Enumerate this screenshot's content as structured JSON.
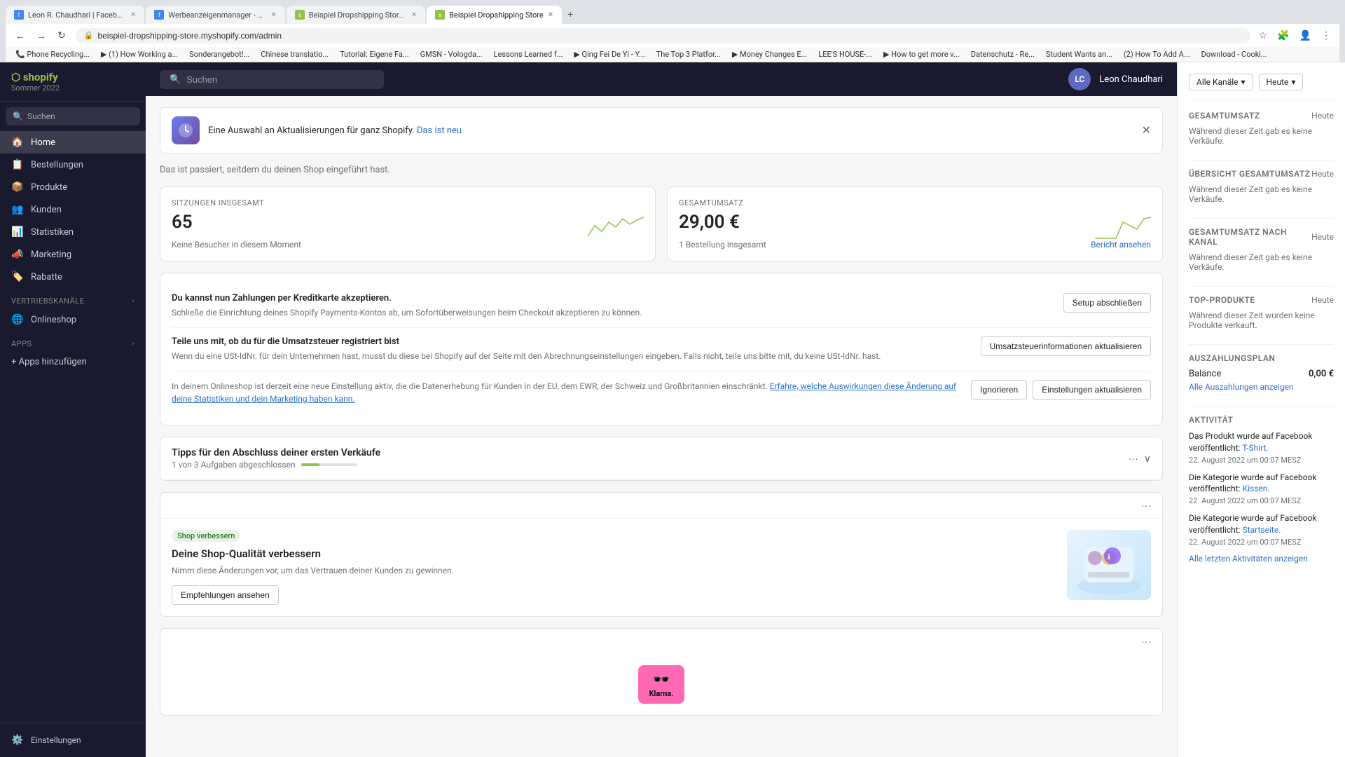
{
  "browser": {
    "tabs": [
      {
        "label": "Leon R. Chaudhari | Facebook",
        "active": false,
        "favicon": "f"
      },
      {
        "label": "Werbeanzeigenmanager - W...",
        "active": false,
        "favicon": "f"
      },
      {
        "label": "Beispiel Dropshipping Store ...",
        "active": false,
        "favicon": "s"
      },
      {
        "label": "Beispiel Dropshipping Store",
        "active": true,
        "favicon": "s"
      }
    ],
    "address": "beispiel-dropshipping-store.myshopify.com/admin",
    "bookmarks": [
      "Phone Recycling...",
      "(1) How Working a...",
      "Sonderangebot!...",
      "Chinese translatio...",
      "Tutorial: Eigene Fa...",
      "GMSN - Vologda...",
      "Lessons Learned f...",
      "Qing Fei De Yi - Y...",
      "The Top 3 Platfor...",
      "Money Changes E...",
      "LEE'S HOUSE-...",
      "How to get more v...",
      "Datenschutz - Re...",
      "Student Wants an...",
      "(2) How To Add A...",
      "Download - Cooki..."
    ]
  },
  "shopify": {
    "logo": "shopify",
    "subtitle": "Sommer 2022",
    "search_placeholder": "Suchen"
  },
  "sidebar": {
    "nav_items": [
      {
        "id": "home",
        "label": "Home",
        "icon": "🏠",
        "active": true
      },
      {
        "id": "bestellungen",
        "label": "Bestellungen",
        "icon": "📋",
        "active": false
      },
      {
        "id": "produkte",
        "label": "Produkte",
        "icon": "📦",
        "active": false
      },
      {
        "id": "kunden",
        "label": "Kunden",
        "icon": "👥",
        "active": false
      },
      {
        "id": "statistiken",
        "label": "Statistiken",
        "icon": "📊",
        "active": false
      },
      {
        "id": "marketing",
        "label": "Marketing",
        "icon": "📣",
        "active": false
      },
      {
        "id": "rabatte",
        "label": "Rabatte",
        "icon": "🏷️",
        "active": false
      }
    ],
    "vertriebskanaele_label": "Vertriebskanäle",
    "onlineshop_label": "Onlineshop",
    "apps_label": "Apps",
    "add_app_label": "+ Apps hinzufügen",
    "settings_label": "Einstellungen"
  },
  "topbar": {
    "search_placeholder": "Suchen",
    "user_initials": "LC",
    "user_name": "Leon Chaudhari"
  },
  "notification": {
    "text": "Eine Auswahl an Aktualisierungen für ganz Shopify.",
    "link_text": "Das ist neu"
  },
  "intro_text": "Das ist passiert, seitdem du deinen Shop eingeführt hast.",
  "stats": {
    "sessions_label": "SITZUNGEN INSGESAMT",
    "sessions_value": "65",
    "sessions_footer": "Keine Besucher in diesem Moment",
    "revenue_label": "GESAMTUMSATZ",
    "revenue_value": "29,00 €",
    "revenue_footer": "1 Bestellung insgesamt",
    "report_link": "Bericht ansehen"
  },
  "setup_items": [
    {
      "title": "Du kannst nun Zahlungen per Kreditkarte akzeptieren.",
      "desc": "Schließe die Einrichtung deines Shopify Payments-Kontos ab, um Sofortüberweisungen beim Checkout akzeptieren zu können.",
      "button": "Setup abschließen"
    },
    {
      "title": "Teile uns mit, ob du für die Umsatzsteuer registriert bist",
      "desc": "Wenn du eine USt-IdNr. für dein Unternehmen hast, musst du diese bei Shopify auf der Seite mit den Abrechnungseinstellungen eingeben. Falls nicht, teile uns bitte mit, du keine USt-IdNr. hast.",
      "button": "Umsatzsteuerinformationen aktualisieren"
    },
    {
      "title": "",
      "desc": "In deinem Onlineshop ist derzeit eine neue Einstellung aktiv, die die Datenerhebung für Kunden in der EU, dem EWR, der Schweiz und Großbritannien einschränkt.",
      "desc_link_text": "Erfahre, welche Auswirkungen diese Änderung auf deine Statistiken und dein Marketing haben kann.",
      "button_ignore": "Ignorieren",
      "button_update": "Einstellungen aktualisieren"
    }
  ],
  "tips": {
    "title": "Tipps für den Abschluss deiner ersten Verkäufe",
    "progress_text": "1 von 3 Aufgaben abgeschlossen",
    "progress_percent": 33
  },
  "quality_card": {
    "badge": "Shop verbessern",
    "title": "Deine Shop-Qualität verbessern",
    "desc": "Nimm diese Änderungen vor, um das Vertrauen deiner Kunden zu gewinnen.",
    "button": "Empfehlungen ansehen"
  },
  "right_panel": {
    "channel_label": "Alle Kanäle",
    "date_label": "Heute",
    "total_revenue_label": "GESAMTUMSATZ",
    "total_revenue_value": "Heute",
    "total_revenue_note": "Während dieser Zeit gab es keine Verkäufe.",
    "overview_label": "ÜBERSICHT GESAMTUMSATZ",
    "overview_value": "Heute",
    "overview_note": "Während dieser Zeit gab es keine Verkäufe.",
    "by_channel_label": "GESAMTUMSATZ NACH KANAL",
    "by_channel_value": "Heute",
    "by_channel_note": "Während dieser Zeit gab es keine Verkäufe.",
    "top_products_label": "TOP-PRODUKTE",
    "top_products_value": "Heute",
    "top_products_note": "Während dieser Zeit wurden keine Produkte verkauft.",
    "payout_label": "AUSZAHLUNGSPLAN",
    "balance_label": "Balance",
    "balance_value": "0,00 €",
    "all_payouts_link": "Alle Auszahlungen anzeigen",
    "activity_label": "AKTIVITÄT",
    "activities": [
      {
        "text": "Das Produkt wurde auf Facebook veröffentlicht:",
        "link": "T-Shirt.",
        "date": "22. August 2022 um 00:07 MESZ"
      },
      {
        "text": "Die Kategorie wurde auf Facebook veröffentlicht:",
        "link": "Kissen.",
        "date": "22. August 2022 um 00:07 MESZ"
      },
      {
        "text": "Die Kategorie wurde auf Facebook veröffentlicht:",
        "link": "Startseite.",
        "date": "22. August 2022 um 00:07 MESZ"
      }
    ],
    "all_activity_link": "Alle letzten Aktivitäten anzeigen"
  }
}
